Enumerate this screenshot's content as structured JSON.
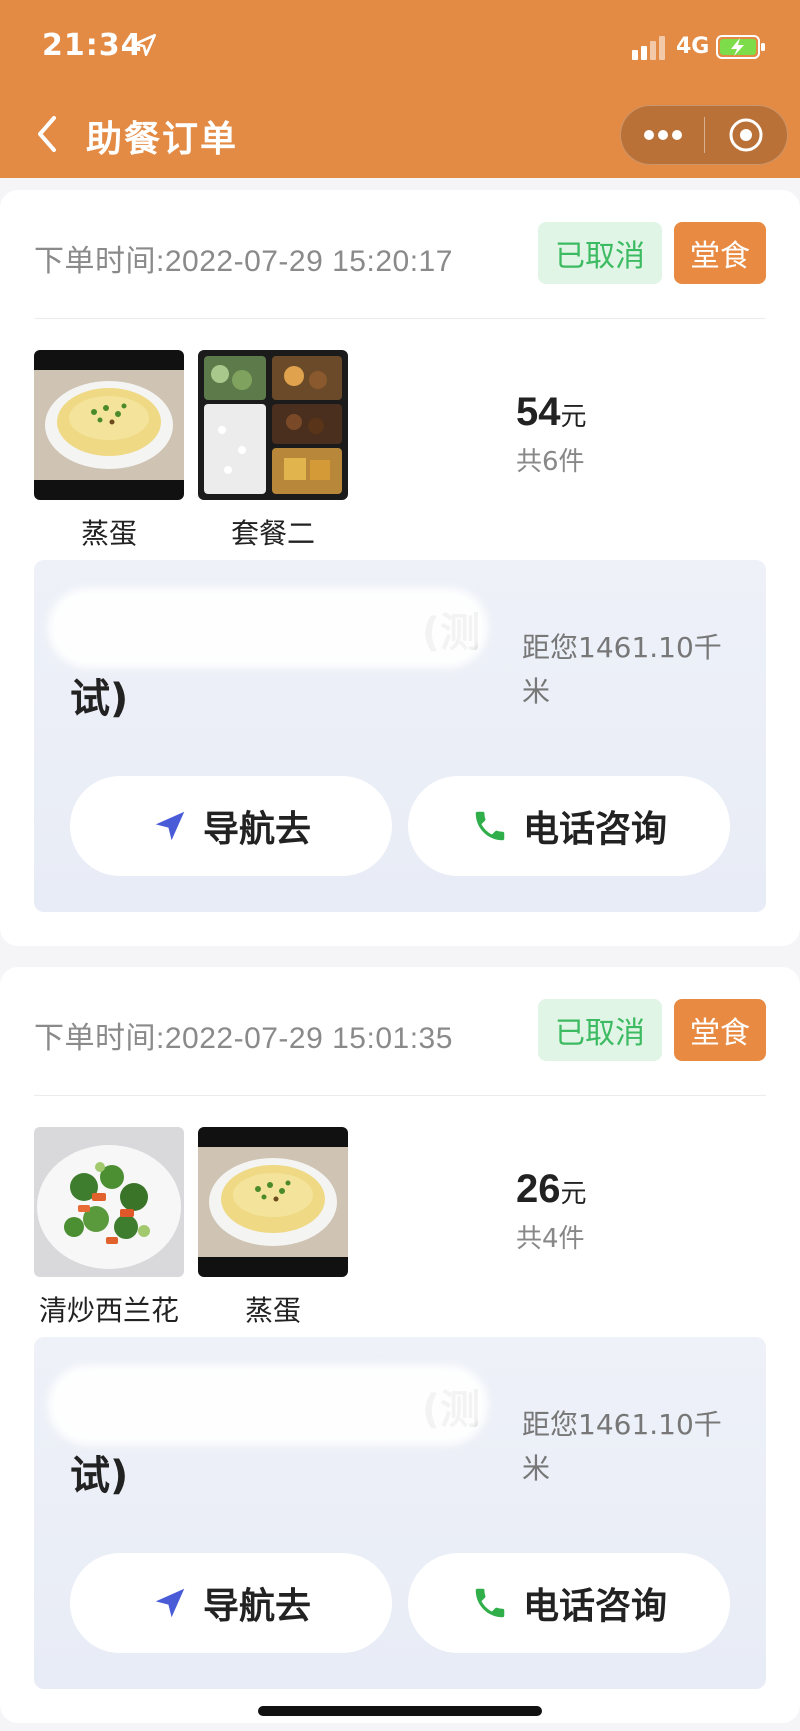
{
  "status_bar": {
    "time": "21:34",
    "network": "4G"
  },
  "nav": {
    "title": "助餐订单"
  },
  "colors": {
    "brand": "#e38a44",
    "status_green": "#3dbb62",
    "nav_icon": "#4a5bd8",
    "phone_icon": "#2fae4a"
  },
  "orders": [
    {
      "order_time": "下单时间:2022-07-29 15:20:17",
      "status": "已取消",
      "type": "堂食",
      "dishes": [
        {
          "name": "蒸蛋",
          "icon": "steamed-egg-photo"
        },
        {
          "name": "套餐二",
          "icon": "set-meal-photo"
        }
      ],
      "price": "54",
      "price_unit": "元",
      "count": "共6件",
      "store_name_visible": "(测",
      "store_name_line2": "试)",
      "distance": "距您1461.10千米",
      "nav_label": "导航去",
      "call_label": "电话咨询"
    },
    {
      "order_time": "下单时间:2022-07-29 15:01:35",
      "status": "已取消",
      "type": "堂食",
      "dishes": [
        {
          "name": "清炒西兰花",
          "icon": "broccoli-photo"
        },
        {
          "name": "蒸蛋",
          "icon": "steamed-egg-photo"
        }
      ],
      "price": "26",
      "price_unit": "元",
      "count": "共4件",
      "store_name_visible": "(测",
      "store_name_line2": "试)",
      "distance": "距您1461.10千米",
      "nav_label": "导航去",
      "call_label": "电话咨询"
    }
  ]
}
